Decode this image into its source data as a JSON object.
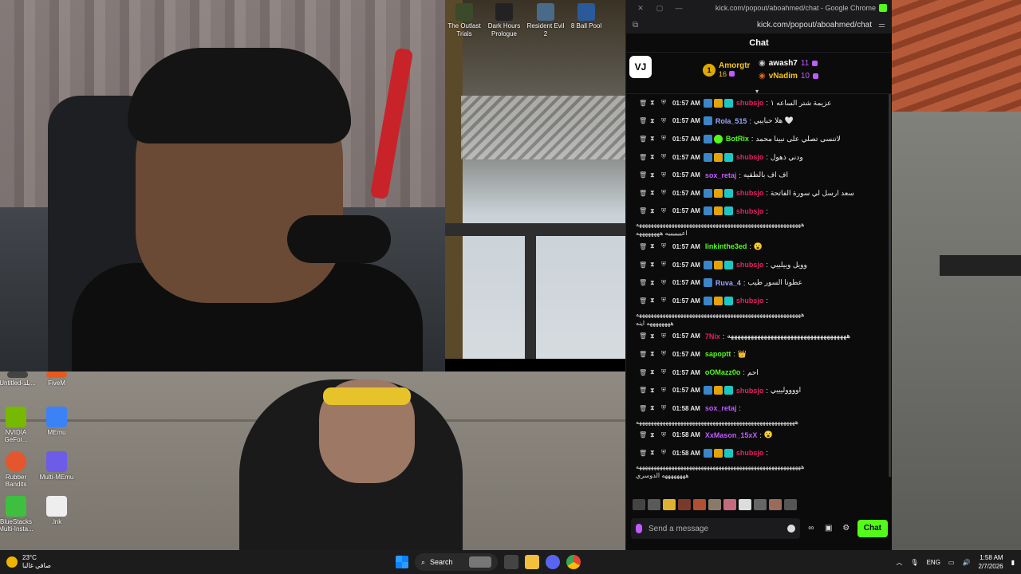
{
  "browser": {
    "title": "kick.com/popout/aboahmed/chat - Google Chrome",
    "url": "kick.com/popout/aboahmed/chat"
  },
  "chat": {
    "header": "Chat",
    "pinned_logo": "VJ",
    "leaderboard": [
      {
        "rank": "1",
        "name": "Amorgtr",
        "count": "16"
      },
      {
        "name": "awash7",
        "count": "11"
      },
      {
        "name": "vNadim",
        "count": "10"
      }
    ],
    "messages": [
      {
        "time": "01:57 AM",
        "user": "shubsjo",
        "user_color": "#e91e63",
        "text": "عزيمة شتر الساعه ١",
        "badges": [
          "blue",
          "gold",
          "cyan"
        ]
      },
      {
        "time": "01:57 AM",
        "user": "Rola_515",
        "user_color": "#9aa6ff",
        "text": "هلا حبايبي 🤍",
        "badges": [
          "blue"
        ]
      },
      {
        "time": "01:57 AM",
        "user": "BotRix",
        "user_color": "#53fc18",
        "text": "لاتنسى تصلي على نبينا محمد",
        "badges": [
          "blue",
          "green"
        ]
      },
      {
        "time": "01:57 AM",
        "user": "shubsjo",
        "user_color": "#e91e63",
        "text": "ودني ذهول",
        "badges": [
          "blue",
          "gold",
          "cyan"
        ]
      },
      {
        "time": "01:57 AM",
        "user": "sox_retaj",
        "user_color": "#c15bff",
        "text": "اف اف بالطقيه",
        "badges": []
      },
      {
        "time": "01:57 AM",
        "user": "shubsjo",
        "user_color": "#e91e63",
        "text": "سعد ارسل لي سورة الفاتحة",
        "badges": [
          "blue",
          "gold",
          "cyan"
        ]
      },
      {
        "time": "01:57 AM",
        "user": "shubsjo",
        "user_color": "#e91e63",
        "text": "",
        "badges": [
          "blue",
          "gold",
          "cyan"
        ]
      }
    ],
    "wrap1a": "ههههههههههههههههههههههههههههههههههههههههههههههههههههههههه",
    "wrap1b": "اعيييييييه ههههههههه",
    "messages2": [
      {
        "time": "01:57 AM",
        "user": "linkinthe3ed",
        "user_color": "#53fc18",
        "text": "😮",
        "badges": []
      },
      {
        "time": "01:57 AM",
        "user": "shubsjo",
        "user_color": "#e91e63",
        "text": "وويل وييلييي",
        "badges": [
          "blue",
          "gold",
          "cyan"
        ]
      },
      {
        "time": "01:57 AM",
        "user": "Ruva_4",
        "user_color": "#9aa6ff",
        "text": "عطونا السور طيب",
        "badges": [
          "blue"
        ]
      },
      {
        "time": "01:57 AM",
        "user": "shubsjo",
        "user_color": "#e91e63",
        "text": "",
        "badges": [
          "blue",
          "gold",
          "cyan"
        ]
      }
    ],
    "wrap2a": "ههههههههههههههههههههههههههههههههههههههههههههههههههههههههه",
    "wrap2b": "ههههههههه اينه",
    "messages3": [
      {
        "time": "01:57 AM",
        "user": "7Nix",
        "user_color": "#e91e63",
        "text": "ههههههههههههههههههههههههههههههههههههه",
        "badges": []
      },
      {
        "time": "01:57 AM",
        "user": "sapoptt",
        "user_color": "#53fc18",
        "text": "👑",
        "badges": []
      },
      {
        "time": "01:57 AM",
        "user": "oOMazz0o",
        "user_color": "#53fc18",
        "text": "احم",
        "badges": []
      },
      {
        "time": "01:57 AM",
        "user": "shubsjo",
        "user_color": "#e91e63",
        "text": "اووووليييي",
        "badges": [
          "blue",
          "gold",
          "cyan"
        ]
      },
      {
        "time": "01:58 AM",
        "user": "sox_retaj",
        "user_color": "#c15bff",
        "text": "",
        "badges": []
      }
    ],
    "wrap3a": "ههههههههههههههههههههههههههههههههههههههههههههههههههههههه",
    "messages4": [
      {
        "time": "01:58 AM",
        "user": "XxMason_15xX",
        "user_color": "#c15bff",
        "text": "😮",
        "badges": []
      },
      {
        "time": "01:58 AM",
        "user": "shubsjo",
        "user_color": "#e91e63",
        "text": "",
        "badges": [
          "blue",
          "gold",
          "cyan"
        ]
      }
    ],
    "wrap4a": "ههههههههههههههههههههههههههههههههههههههههههههههههههههههههه",
    "wrap4b": "ههههههههه الدوسري",
    "input_placeholder": "Send a message",
    "send_label": "Chat"
  },
  "desktop": {
    "shortcuts_top": [
      {
        "label": "The Outlast Trials"
      },
      {
        "label": "Dark Hours Prologue"
      },
      {
        "label": "Resident Evil 2"
      },
      {
        "label": "8 Ball Pool"
      }
    ],
    "icons": [
      {
        "label": "Untitled-بلد..."
      },
      {
        "label": "FiveM"
      },
      {
        "label": "NVIDIA GeFor..."
      },
      {
        "label": "MEmu"
      },
      {
        "label": "Rubber Bandits"
      },
      {
        "label": "Multi-MEmu"
      },
      {
        "label": "BlueStacks Multi-Insta..."
      },
      {
        "label": ".lnk"
      }
    ]
  },
  "taskbar": {
    "temp": "23°C",
    "weather": "صافي غالبا",
    "search": "Search",
    "lang": "ENG",
    "time": "1:58 AM",
    "date": "2/7/2026"
  },
  "colors": {
    "kick_green": "#53fc18",
    "chat_bg": "#0b0b0c"
  }
}
